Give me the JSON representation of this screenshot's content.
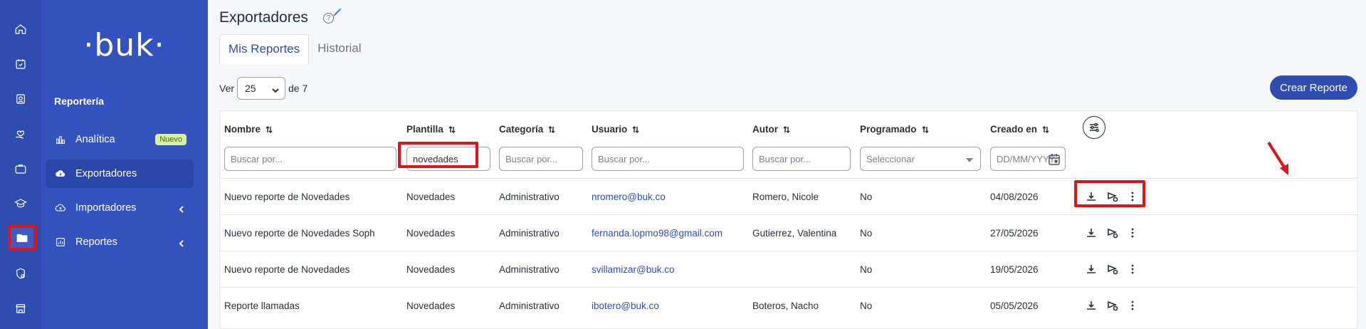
{
  "sidebar": {
    "logo": "·buk·",
    "section": "Reportería",
    "items": [
      {
        "label": "Analítica",
        "badge": "Nuevo"
      },
      {
        "label": "Exportadores"
      },
      {
        "label": "Importadores"
      },
      {
        "label": "Reportes"
      }
    ]
  },
  "page": {
    "title": "Exportadores",
    "tabs": [
      {
        "label": "Mis Reportes"
      },
      {
        "label": "Historial"
      }
    ],
    "pagination": {
      "prefix": "Ver",
      "value": "25",
      "suffix": "de 7"
    },
    "create_button": "Crear Reporte"
  },
  "table": {
    "columns": [
      "Nombre",
      "Plantilla",
      "Categoría",
      "Usuario",
      "Autor",
      "Programado",
      "Creado en"
    ],
    "filters": {
      "nombre_placeholder": "Buscar por...",
      "plantilla_value": "novedades",
      "categoria_placeholder": "Buscar por...",
      "usuario_placeholder": "Buscar por...",
      "autor_placeholder": "Buscar por...",
      "programado_placeholder": "Seleccionar",
      "fecha_placeholder": "DD/MM/YYYY"
    },
    "rows": [
      {
        "nombre": "Nuevo reporte de Novedades",
        "plantilla": "Novedades",
        "categoria": "Administrativo",
        "usuario": "nromero@buk.co",
        "autor": "Romero, Nicole",
        "programado": "No",
        "creado": "04/08/2026"
      },
      {
        "nombre": "Nuevo reporte de Novedades Soph",
        "plantilla": "Novedades",
        "categoria": "Administrativo",
        "usuario": "fernanda.lopmo98@gmail.com",
        "autor": "Gutierrez, Valentina",
        "programado": "No",
        "creado": "27/05/2026"
      },
      {
        "nombre": "Nuevo reporte de Novedades",
        "plantilla": "Novedades",
        "categoria": "Administrativo",
        "usuario": "svillamizar@buk.co",
        "autor": "",
        "programado": "No",
        "creado": "19/05/2026"
      },
      {
        "nombre": "Reporte llamadas",
        "plantilla": "Novedades",
        "categoria": "Administrativo",
        "usuario": "ibotero@buk.co",
        "autor": "Boteros, Nacho",
        "programado": "No",
        "creado": "05/05/2026"
      }
    ]
  },
  "colors": {
    "primary": "#2f4db1",
    "sidebar": "#3553bf",
    "rail": "#2f4db1",
    "highlight": "#e0141b",
    "badge_bg": "#d5f0a0"
  }
}
